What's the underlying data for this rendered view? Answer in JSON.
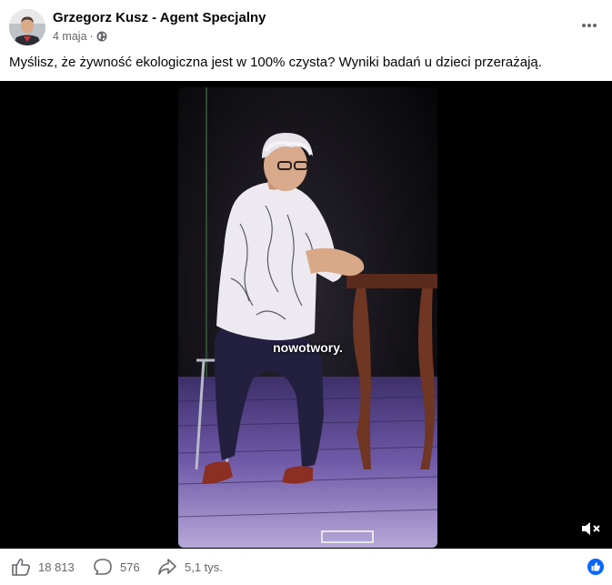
{
  "post": {
    "author": "Grzegorz Kusz - Agent Specjalny",
    "date": "4 maja",
    "separator": "·",
    "privacy_icon": "globe-icon",
    "more_icon": "more-horizontal-icon",
    "text": "Myślisz, że żywność ekologiczna jest w 100% czysta? Wyniki badań u dzieci przerażają."
  },
  "video": {
    "caption": "nowotwory.",
    "mute_icon": "volume-muted-icon"
  },
  "actions": {
    "likes": "18 813",
    "comments": "576",
    "shares": "5,1 tys."
  },
  "colors": {
    "text": "#050505",
    "secondary": "#65676b",
    "brand_blue": "#0866ff"
  }
}
